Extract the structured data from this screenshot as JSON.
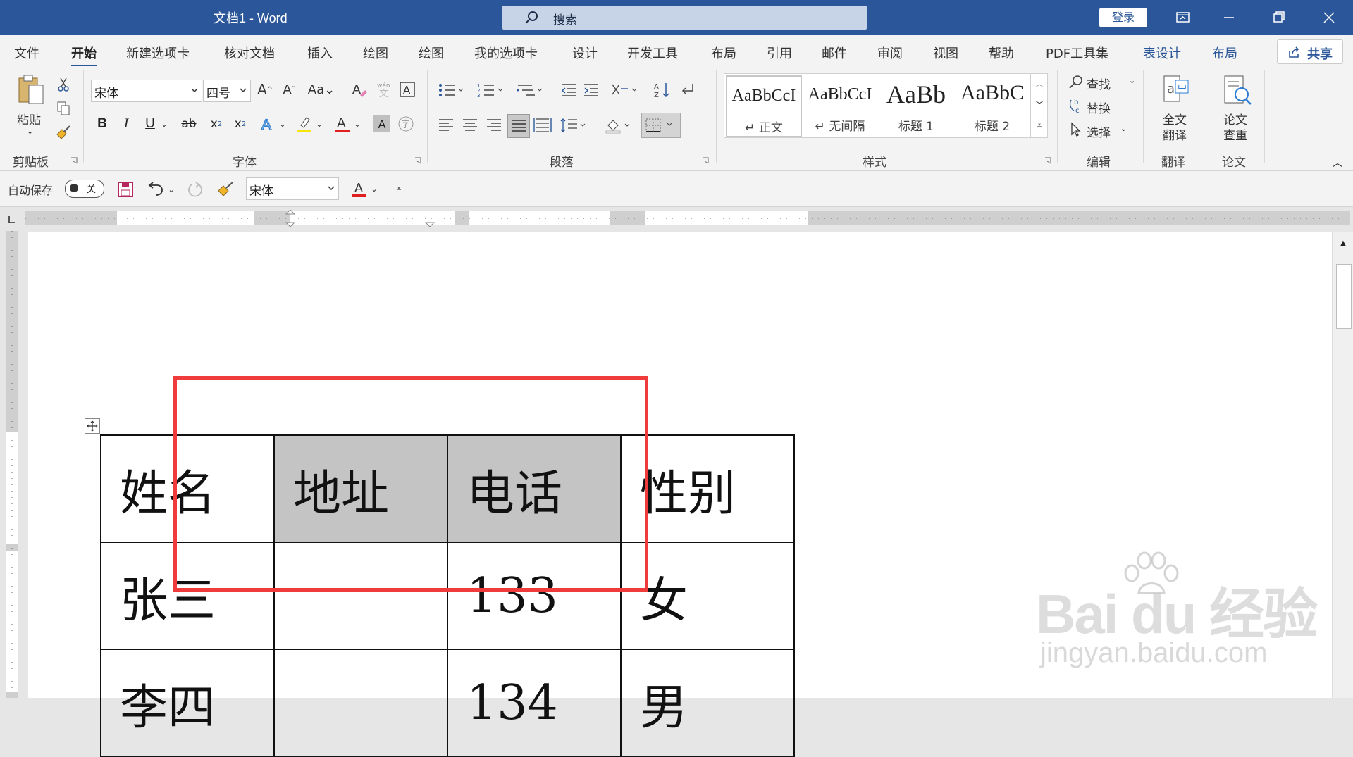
{
  "app": {
    "doc_title": "文档1  -  Word",
    "search_placeholder": "搜索",
    "login_label": "登录"
  },
  "menu": {
    "items": [
      "文件",
      "开始",
      "新建选项卡",
      "核对文档",
      "插入",
      "绘图",
      "绘图",
      "我的选项卡",
      "设计",
      "开发工具",
      "布局",
      "引用",
      "邮件",
      "审阅",
      "视图",
      "帮助",
      "PDF工具集"
    ],
    "active_index": 1,
    "context_tabs": [
      "表设计",
      "布局"
    ],
    "share_label": "共享"
  },
  "ribbon": {
    "clipboard": {
      "paste_label": "粘贴",
      "group_label": "剪贴板"
    },
    "font": {
      "font_name": "宋体",
      "font_size": "四号",
      "group_label": "字体",
      "font_color": "#e02020",
      "highlight_color": "#f5e50a"
    },
    "paragraph": {
      "group_label": "段落"
    },
    "styles": {
      "group_label": "样式",
      "items": [
        {
          "sample": "AaBbCcI",
          "name": "↵ 正文"
        },
        {
          "sample": "AaBbCcI",
          "name": "↵ 无间隔"
        },
        {
          "sample": "AaBb",
          "name": "标题 1"
        },
        {
          "sample": "AaBbC",
          "name": "标题 2"
        }
      ]
    },
    "editing": {
      "find_label": "查找",
      "replace_label": "替换",
      "select_label": "选择",
      "group_label": "编辑"
    },
    "translate": {
      "button_label_1": "全文",
      "button_label_2": "翻译",
      "group_label": "翻译"
    },
    "paper": {
      "button_label_1": "论文",
      "button_label_2": "查重",
      "group_label": "论文"
    }
  },
  "qat": {
    "autosave_label": "自动保存",
    "autosave_state": "关",
    "font_name": "宋体"
  },
  "table": {
    "rows": [
      [
        "姓名",
        "地址",
        "电话",
        "性别"
      ],
      [
        "张三",
        "",
        "133",
        "女"
      ],
      [
        "李四",
        "",
        "134",
        "男"
      ]
    ],
    "highlighted_cells": [
      [
        0,
        1
      ],
      [
        0,
        2
      ]
    ]
  },
  "watermark": {
    "brand": "Bai du 经验",
    "url": "jingyan.baidu.com"
  }
}
